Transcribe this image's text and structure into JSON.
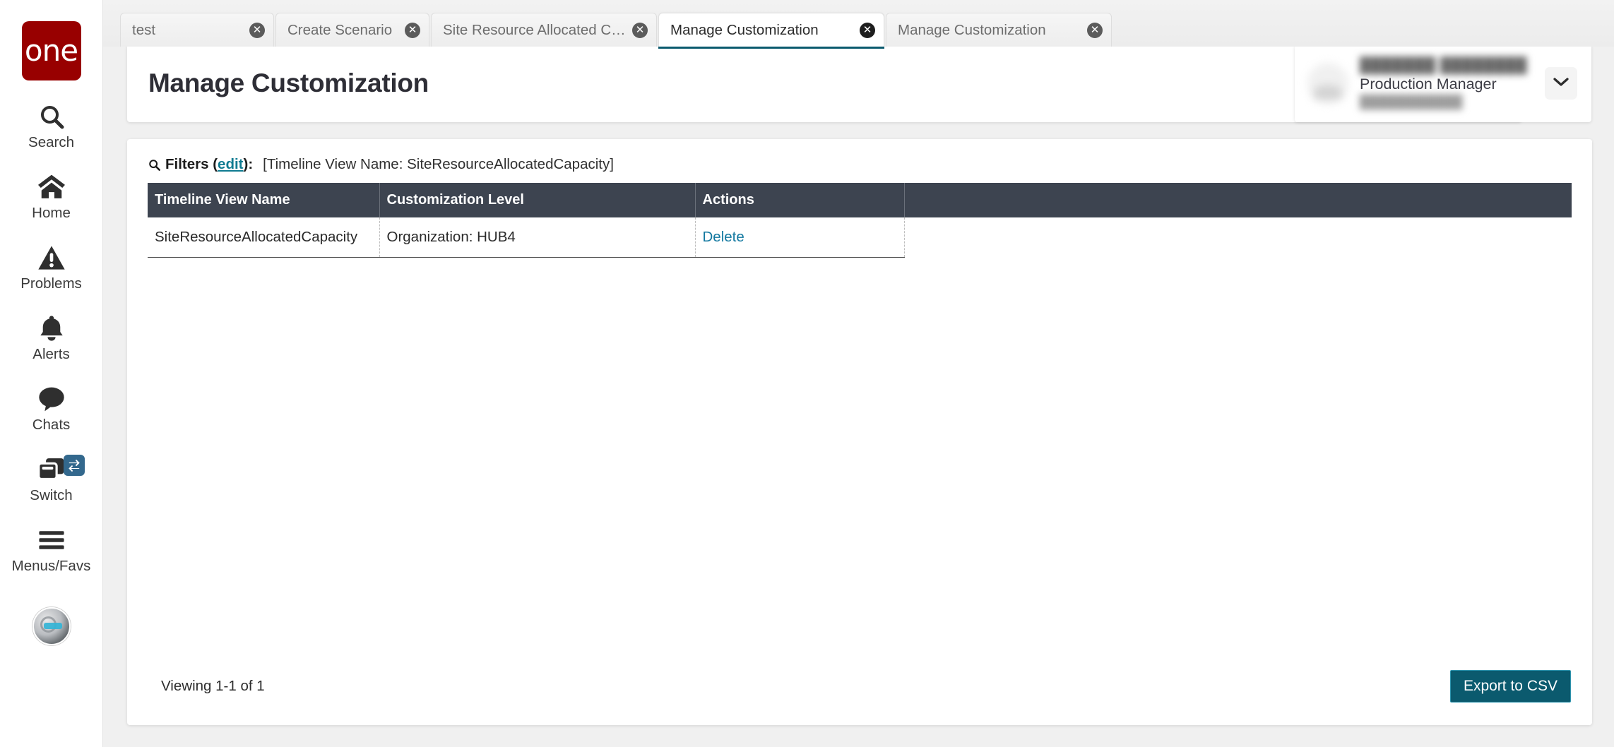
{
  "brand": {
    "logo_text": "one",
    "logo_color": "#980000"
  },
  "sidebar": {
    "items": [
      {
        "label": "Search",
        "icon": "search-icon"
      },
      {
        "label": "Home",
        "icon": "home-icon"
      },
      {
        "label": "Problems",
        "icon": "warning-triangle-icon"
      },
      {
        "label": "Alerts",
        "icon": "bell-icon"
      },
      {
        "label": "Chats",
        "icon": "chat-bubble-icon"
      },
      {
        "label": "Switch",
        "icon": "switch-windows-icon"
      },
      {
        "label": "Menus/Favs",
        "icon": "hamburger-icon"
      }
    ],
    "avatar": "assistant-avatar"
  },
  "tabs": [
    {
      "label": "test",
      "active": false
    },
    {
      "label": "Create Scenario",
      "active": false
    },
    {
      "label": "Site Resource Allocated Capacity",
      "active": false
    },
    {
      "label": "Manage Customization",
      "active": true
    },
    {
      "label": "Manage Customization",
      "active": false
    }
  ],
  "tab_close_glyph": "✕",
  "header": {
    "title": "Manage Customization",
    "actions": [
      {
        "name": "favorite-button",
        "icon": "star-icon"
      },
      {
        "name": "refresh-button",
        "icon": "refresh-icon"
      },
      {
        "name": "close-button",
        "icon": "close-x-icon"
      }
    ],
    "menu_favs_badge_icon": "star-icon",
    "accent_color": "#0b5a6e",
    "badge_color": "#9c0c12"
  },
  "user": {
    "name_blurred": "███████ ████████",
    "role": "Production Manager",
    "sub_blurred": "███████████",
    "caret_icon": "chevron-down-icon"
  },
  "filters": {
    "icon": "search-icon",
    "label": "Filters (",
    "edit_label": "edit",
    "label_close": "):",
    "value": "[Timeline View Name: SiteResourceAllocatedCapacity]"
  },
  "table": {
    "columns": [
      "Timeline View Name",
      "Customization Level",
      "Actions",
      ""
    ],
    "rows": [
      {
        "timeline_view_name": "SiteResourceAllocatedCapacity",
        "customization_level": "Organization: HUB4",
        "action_label": "Delete"
      }
    ]
  },
  "footer": {
    "viewing": "Viewing 1-1 of 1",
    "export_label": "Export to CSV"
  }
}
